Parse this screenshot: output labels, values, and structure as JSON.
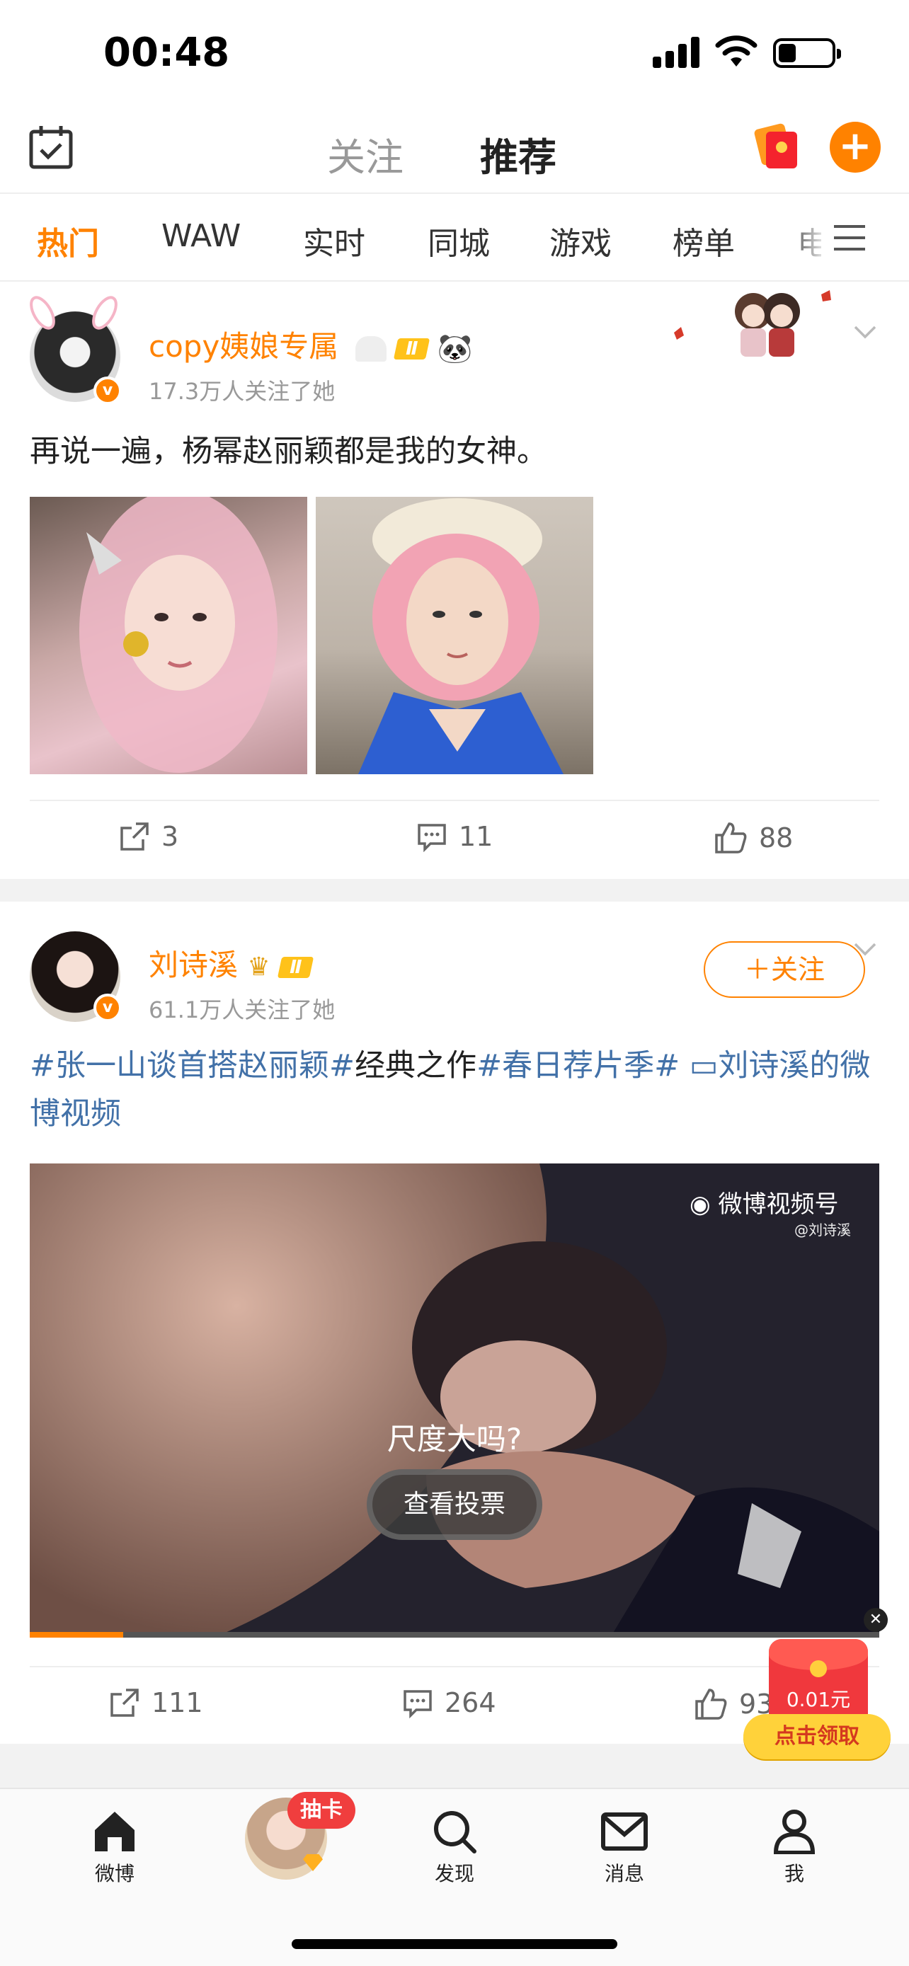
{
  "status_bar": {
    "time": "00:48"
  },
  "header": {
    "tabs": [
      {
        "label": "关注",
        "active": false
      },
      {
        "label": "推荐",
        "active": true
      }
    ]
  },
  "channels": {
    "items": [
      "热门",
      "WAW",
      "实时",
      "同城",
      "游戏",
      "榜单",
      "电影"
    ],
    "active_index": 0
  },
  "posts": [
    {
      "username": "copy姨娘专属",
      "level_badge": "Ⅱ",
      "followers": "17.3万人关注了她",
      "text": "再说一遍，杨幂赵丽颖都是我的女神。",
      "actions": {
        "share": "3",
        "comment": "11",
        "like": "88"
      }
    },
    {
      "username": "刘诗溪",
      "level_badge": "Ⅱ",
      "followers": "61.1万人关注了她",
      "follow_label": "＋关注",
      "text_segments": [
        {
          "text": "#张一山谈首搭赵丽颖#",
          "topic": true
        },
        {
          "text": "经典之作",
          "topic": false
        },
        {
          "text": "#春日荐片季#",
          "topic": true
        },
        {
          "text": " ▭刘诗溪的微博视频",
          "topic": true
        }
      ],
      "video": {
        "watermark": "微博视频号",
        "watermark_sub": "@刘诗溪",
        "poll_question": "尺度大吗?",
        "poll_button": "查看投票",
        "progress_fraction": 0.11
      },
      "actions": {
        "share": "111",
        "comment": "264",
        "like": "93"
      }
    }
  ],
  "promo": {
    "amount": "0.01元",
    "cta": "点击领取"
  },
  "tabbar": {
    "items": [
      {
        "label": "微博",
        "icon": "home-icon"
      },
      {
        "label": "抽卡",
        "icon": "avatar-icon"
      },
      {
        "label": "发现",
        "icon": "search-icon"
      },
      {
        "label": "消息",
        "icon": "mail-icon"
      },
      {
        "label": "我",
        "icon": "person-icon"
      }
    ]
  },
  "colors": {
    "accent": "#ff8200",
    "topic": "#4271a8"
  }
}
